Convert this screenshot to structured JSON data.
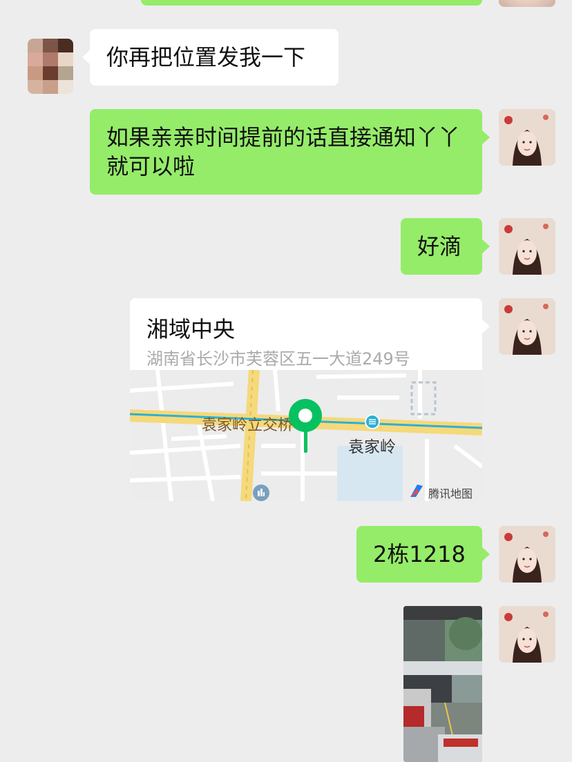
{
  "messages": [
    {
      "id": "m1",
      "sender": "other",
      "type": "text",
      "text": "你再把位置发我一下"
    },
    {
      "id": "m2",
      "sender": "me",
      "type": "text",
      "text": "如果亲亲时间提前的话直接通知丫丫就可以啦"
    },
    {
      "id": "m3",
      "sender": "me",
      "type": "text",
      "text": "好滴"
    },
    {
      "id": "m4",
      "sender": "me",
      "type": "location",
      "title": "湘域中央",
      "address": "湖南省长沙市芙蓉区五一大道249号",
      "map": {
        "labels": [
          "袁家岭立交桥",
          "袁家岭"
        ],
        "provider": "腾讯地图"
      }
    },
    {
      "id": "m5",
      "sender": "me",
      "type": "text",
      "text": "2栋1218"
    },
    {
      "id": "m6",
      "sender": "me",
      "type": "image"
    }
  ],
  "colors": {
    "background": "#ededed",
    "my_bubble": "#95ec69",
    "their_bubble": "#ffffff",
    "pin": "#07c160",
    "map_road_major": "#f5d97a",
    "map_line": "#2bb0d6"
  },
  "icons": {
    "location_pin": "map-pin-icon",
    "metro_station": "metro-icon",
    "poi": "building-poi-icon",
    "provider_logo": "tencent-map-logo-icon"
  }
}
